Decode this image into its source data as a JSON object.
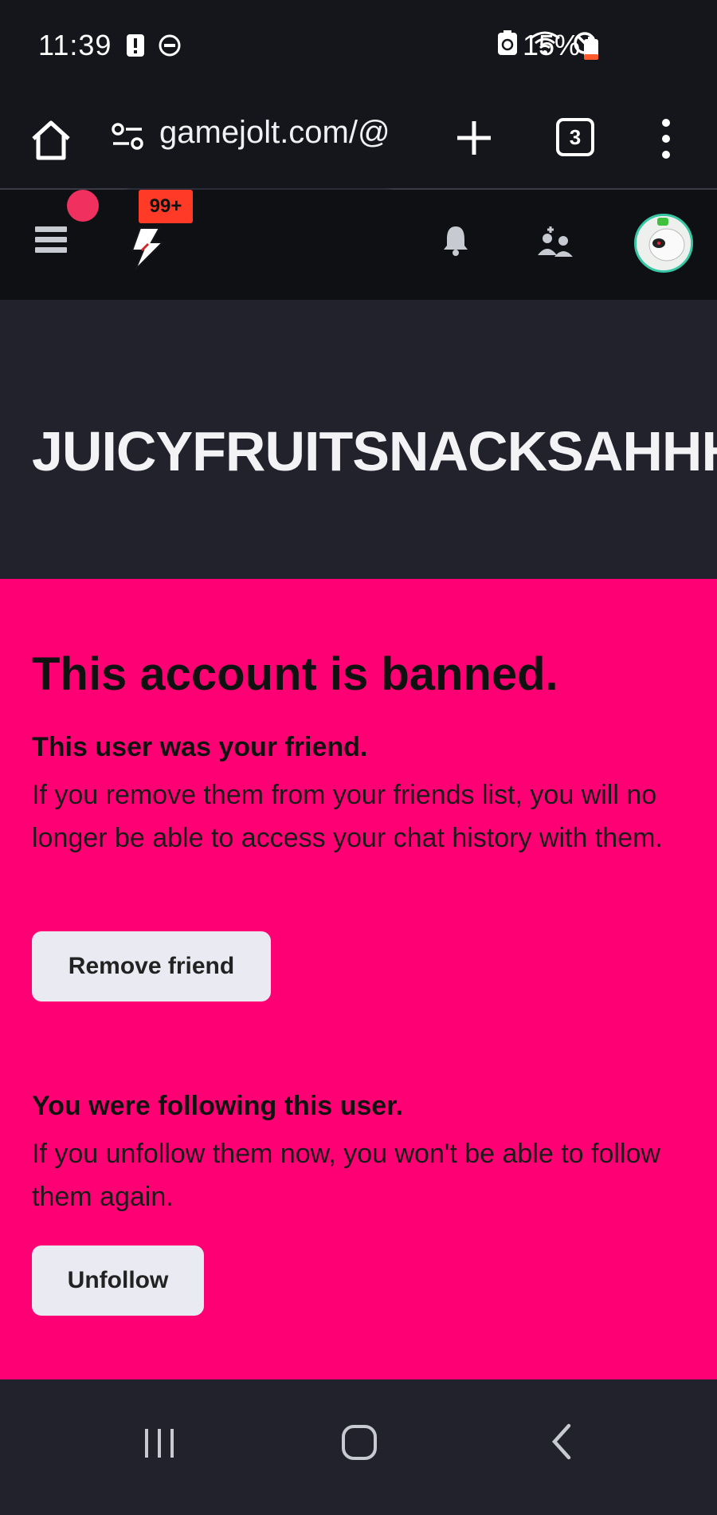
{
  "status_bar": {
    "time": "11:39",
    "battery_percent": "15%"
  },
  "browser": {
    "url": "gamejolt.com/@",
    "tab_count": "3"
  },
  "site_nav": {
    "notification_badge": "99+"
  },
  "profile": {
    "username": "JUICYFRUITSNACKSAHHH"
  },
  "ban_notice": {
    "title": "This account is banned.",
    "friend_section": {
      "heading": "This user was your friend.",
      "body": "If you remove them from your friends list, you will no longer be able to access your chat history with them.",
      "button": "Remove friend"
    },
    "follow_section": {
      "heading": "You were following this user.",
      "body": "If you unfollow them now, you won't be able to follow them again.",
      "button": "Unfollow"
    }
  },
  "colors": {
    "ban_panel": "#ff0074",
    "badge": "#ff3a26",
    "dark_bg": "#21222c"
  }
}
